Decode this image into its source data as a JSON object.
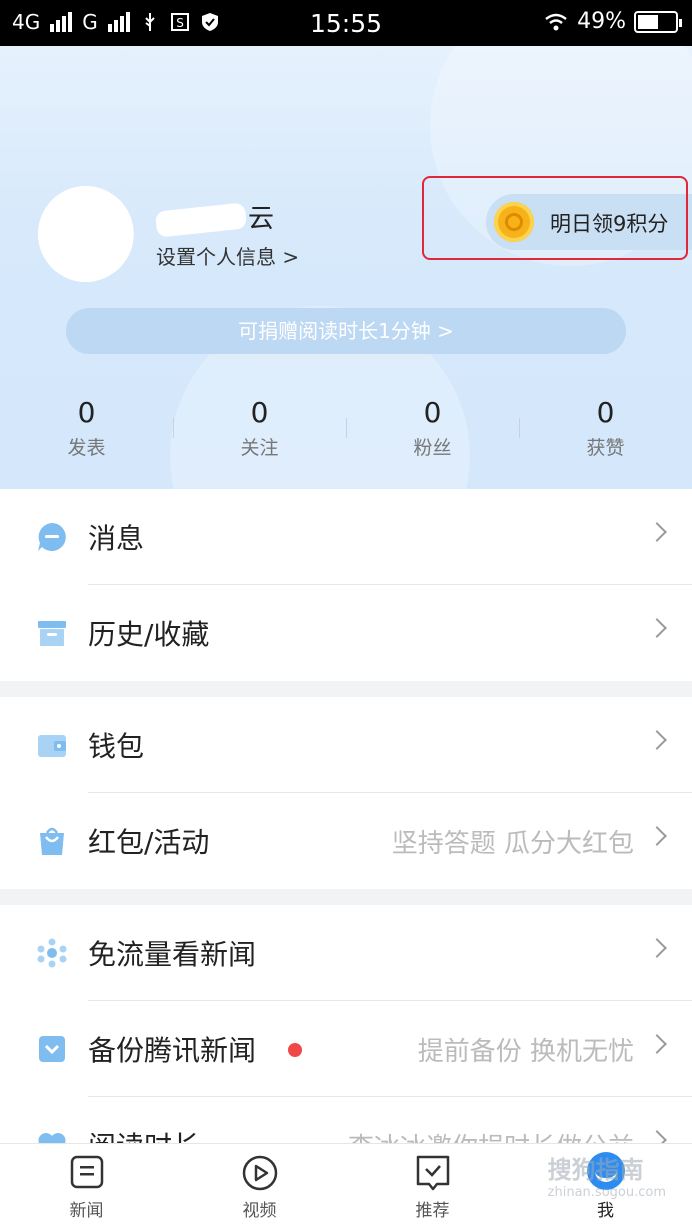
{
  "status_bar": {
    "network1": "4G",
    "network2": "G",
    "time": "15:55",
    "battery": "49%",
    "battery_level": 0.49
  },
  "profile": {
    "username_visible": "云",
    "set_info": "设置个人信息 >",
    "points_label": "明日领9积分",
    "donate": "可捐赠阅读时长1分钟 >"
  },
  "stats": [
    {
      "num": "0",
      "label": "发表"
    },
    {
      "num": "0",
      "label": "关注"
    },
    {
      "num": "0",
      "label": "粉丝"
    },
    {
      "num": "0",
      "label": "获赞"
    }
  ],
  "menu": {
    "messages": "消息",
    "history": "历史/收藏",
    "wallet": "钱包",
    "redpacket": "红包/活动",
    "redpacket_hint": "坚持答题 瓜分大红包",
    "freeflow": "免流量看新闻",
    "backup": "备份腾讯新闻",
    "backup_hint": "提前备份 换机无忧",
    "reading": "阅读时长",
    "reading_hint": "李冰冰邀你捐时长做公益"
  },
  "tabs": {
    "news": "新闻",
    "video": "视频",
    "recommend": "推荐",
    "me": "我"
  },
  "watermark": {
    "main": "搜狗指南",
    "sub": "zhinan.sogou.com"
  },
  "colors": {
    "accent": "#2c8cf0",
    "highlight": "#e0283a"
  }
}
